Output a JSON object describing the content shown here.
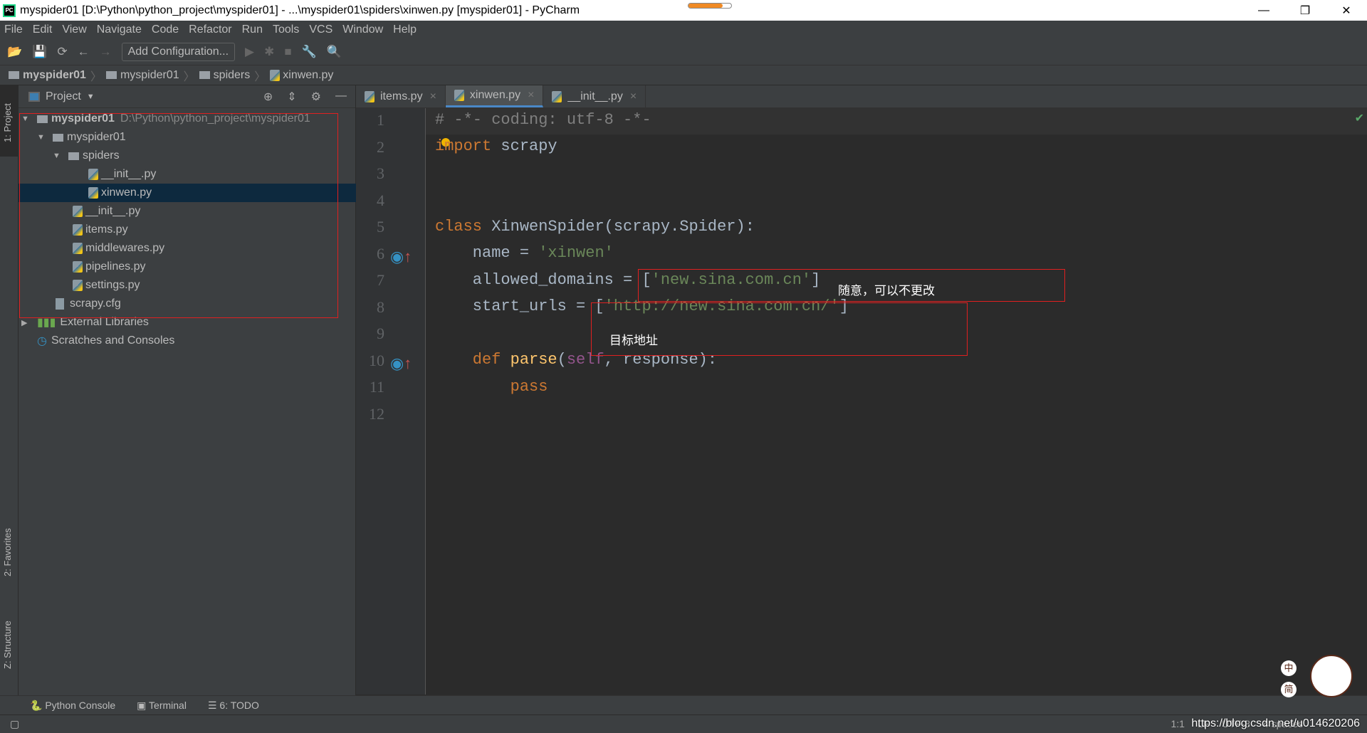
{
  "window": {
    "title": "myspider01 [D:\\Python\\python_project\\myspider01] - ...\\myspider01\\spiders\\xinwen.py [myspider01] - PyCharm",
    "app_badge": "PC",
    "progress_percent": 80
  },
  "menu": [
    "File",
    "Edit",
    "View",
    "Navigate",
    "Code",
    "Refactor",
    "Run",
    "Tools",
    "VCS",
    "Window",
    "Help"
  ],
  "toolbar": {
    "add_configuration": "Add Configuration..."
  },
  "breadcrumb": [
    "myspider01",
    "myspider01",
    "spiders",
    "xinwen.py"
  ],
  "left_strip": {
    "project": "1: Project",
    "favorites": "2: Favorites",
    "structure": "Z: Structure"
  },
  "project_panel": {
    "title": "Project",
    "tree": [
      {
        "label": "myspider01",
        "path": "D:\\Python\\python_project\\myspider01",
        "type": "folder",
        "expanded": true
      },
      {
        "label": "myspider01",
        "type": "package",
        "expanded": true
      },
      {
        "label": "spiders",
        "type": "package",
        "expanded": true
      },
      {
        "label": "__init__.py",
        "type": "py"
      },
      {
        "label": "xinwen.py",
        "type": "py",
        "selected": true
      },
      {
        "label": "__init__.py",
        "type": "py"
      },
      {
        "label": "items.py",
        "type": "py"
      },
      {
        "label": "middlewares.py",
        "type": "py"
      },
      {
        "label": "pipelines.py",
        "type": "py"
      },
      {
        "label": "settings.py",
        "type": "py"
      },
      {
        "label": "scrapy.cfg",
        "type": "cfg"
      },
      {
        "label": "External Libraries",
        "type": "lib"
      },
      {
        "label": "Scratches and Consoles",
        "type": "scratch"
      }
    ]
  },
  "tabs": [
    {
      "label": "items.py"
    },
    {
      "label": "xinwen.py",
      "active": true
    },
    {
      "label": "__init__.py"
    }
  ],
  "code": {
    "line_numbers": [
      "1",
      "2",
      "3",
      "4",
      "5",
      "6",
      "7",
      "8",
      "9",
      "10",
      "11",
      "12"
    ],
    "l1": "# -*- coding: utf-8 -*-",
    "l2_kw": "import",
    "l2_rest": " scrapy",
    "l5_kw": "class",
    "l5_name": " XinwenSpider",
    "l5_rest": "(scrapy.Spider):",
    "l6_a": "    name = ",
    "l6_s": "'xinwen'",
    "l7_a": "    allowed_domains = [",
    "l7_s": "'new.sina.com.cn'",
    "l7_b": "]",
    "l8_a": "    start_urls = [",
    "l8_s": "'http://new.sina.com.cn/'",
    "l8_b": "]",
    "l10_kw": "    def",
    "l10_fn": " parse",
    "l10_p": "(",
    "l10_self": "self",
    "l10_rest": ", response):",
    "l11_kw": "        pass"
  },
  "annotations": {
    "allowed_domains_note": "随意，可以不更改",
    "start_urls_note": "目标地址"
  },
  "bottom_tabs": [
    "Python Console",
    "Terminal",
    "6: TODO"
  ],
  "status": {
    "position": "1:1",
    "line_sep": "LF",
    "encoding": "UTF-8",
    "indent": "4 spaces"
  },
  "watermark": "https://blog.csdn.net/u014620206",
  "ime": [
    "中",
    "简"
  ]
}
